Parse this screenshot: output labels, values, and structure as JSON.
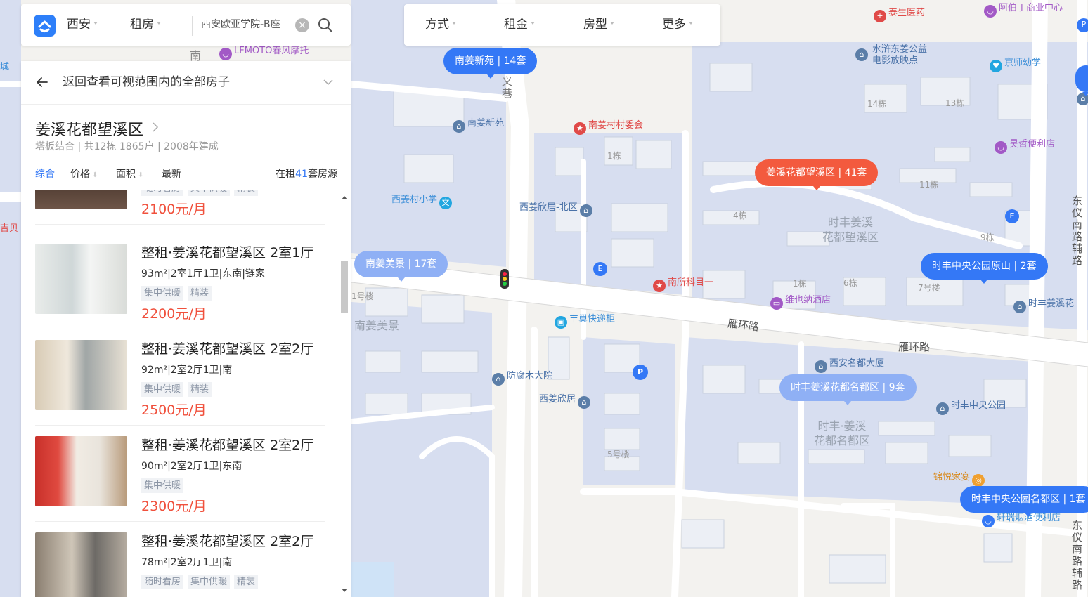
{
  "search": {
    "city": "西安",
    "category": "租房",
    "query": "西安欧亚学院-B座"
  },
  "filters": [
    "方式",
    "租金",
    "房型",
    "更多"
  ],
  "panel": {
    "back_text": "返回查看可视范围内的全部房子",
    "community": {
      "name": "姜溪花都望溪区",
      "info": "塔板结合 | 共12栋 1865户 | 2008年建成"
    },
    "sort": {
      "items": [
        "综合",
        "价格",
        "面积",
        "最新"
      ],
      "active": "综合"
    },
    "count": {
      "prefix": "在租",
      "value": "41",
      "suffix": "套房源"
    },
    "partial_listing": {
      "tags": [
        "随时看房",
        "集中供暖",
        "精装"
      ],
      "price": "2100元/月"
    },
    "listings": [
      {
        "title": "整租·姜溪花都望溪区 2室1厅",
        "meta": "93m²|2室1厅1卫|东南|链家",
        "tags": [
          "集中供暖",
          "精装"
        ],
        "price": "2200元/月"
      },
      {
        "title": "整租·姜溪花都望溪区 2室2厅",
        "meta": "92m²|2室2厅1卫|南",
        "tags": [
          "集中供暖",
          "精装"
        ],
        "price": "2500元/月"
      },
      {
        "title": "整租·姜溪花都望溪区 2室2厅",
        "meta": "90m²|2室2厅1卫|东南",
        "tags": [
          "集中供暖"
        ],
        "price": "2300元/月"
      },
      {
        "title": "整租·姜溪花都望溪区 2室2厅",
        "meta": "78m²|2室2厅1卫|南",
        "tags": [
          "随时看房",
          "集中供暖",
          "精装"
        ],
        "price": ""
      }
    ]
  },
  "map": {
    "bubbles": [
      {
        "text": "南姜新苑 | 14套",
        "style": "blue"
      },
      {
        "text": "姜溪花都望溪区 | 41套",
        "style": "red"
      },
      {
        "text": "南姜美景 | 17套",
        "style": "light"
      },
      {
        "text": "时丰中央公园原山 | 2套",
        "style": "blue"
      },
      {
        "text": "时丰姜溪花都名都区 | 9套",
        "style": "light"
      },
      {
        "text": "时丰中央公园名都区 | 1套",
        "style": "blue"
      }
    ],
    "pois": [
      {
        "name": "泰生医药",
        "color": "#e04a48"
      },
      {
        "name": "阿伯丁商业中心",
        "color": "#a259c6"
      },
      {
        "name": "LFMOTO春风摩托",
        "color": "#a259c6"
      },
      {
        "name": "水浒东姜公益电影放映点",
        "color": "#5b7ea8"
      },
      {
        "name": "京师幼学",
        "color": "#22a6e0"
      },
      {
        "name": "南姜新苑",
        "color": "#5b7ea8"
      },
      {
        "name": "南姜村村委会",
        "color": "#e04a48"
      },
      {
        "name": "昊哲便利店",
        "color": "#a259c6"
      },
      {
        "name": "西姜村小学",
        "color": "#22a6e0"
      },
      {
        "name": "西姜欣居-北区",
        "color": "#5b7ea8"
      },
      {
        "name": "南所科目一",
        "color": "#e04a48"
      },
      {
        "name": "维也纳酒店",
        "color": "#a259c6"
      },
      {
        "name": "时丰姜溪花",
        "color": "#5b7ea8"
      },
      {
        "name": "丰巢快递柜",
        "color": "#22a6e0"
      },
      {
        "name": "西安名都大厦",
        "color": "#5b7ea8"
      },
      {
        "name": "防腐木大院",
        "color": "#5b7ea8"
      },
      {
        "name": "西姜欣居",
        "color": "#5b7ea8"
      },
      {
        "name": "时丰中央公园",
        "color": "#5b7ea8"
      },
      {
        "name": "锦悦家宴",
        "color": "#f0a030"
      },
      {
        "name": "轩瑞烟酒便利店",
        "color": "#3478f6"
      }
    ],
    "labels": [
      "南",
      "义巷",
      "14栋",
      "13栋",
      "1栋",
      "11栋",
      "4栋",
      "时丰姜溪",
      "花都望溪区",
      "9栋",
      "1号楼",
      "1栋",
      "6栋",
      "7号楼",
      "南姜美景",
      "雁环路",
      "雁环路",
      "时丰·姜溪",
      "花都名都区",
      "5号楼",
      "东仪南路辅路",
      "东仪南路辅路",
      "城",
      "吉贝"
    ]
  }
}
